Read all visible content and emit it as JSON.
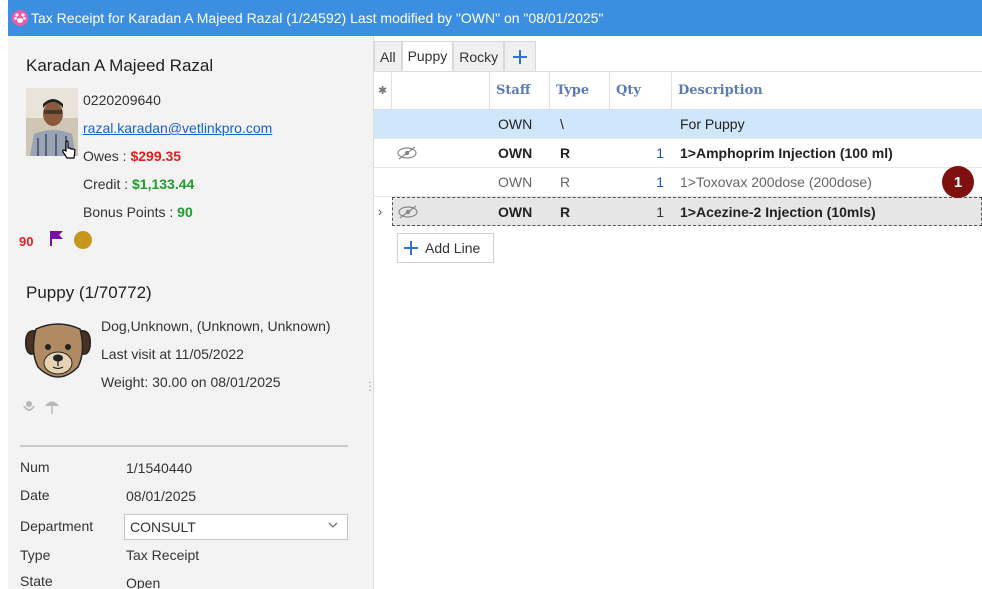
{
  "window": {
    "title": "Tax Receipt for Karadan A Majeed Razal (1/24592) Last modified by \"OWN\" on \"08/01/2025\""
  },
  "client": {
    "name": "Karadan A Majeed Razal",
    "phone": "0220209640",
    "email": "razal.karadan@vetlinkpro.com",
    "owes_label": "Owes : ",
    "owes_value": "$299.35",
    "credit_label": "Credit : ",
    "credit_value": "$1,133.44",
    "bonus_label": "Bonus Points : ",
    "bonus_value": "90",
    "badge_value": "90",
    "colors": {
      "owes": "#e02020",
      "credit": "#1e9d2c",
      "flag": "#7a0fa8",
      "coin": "#c8961f"
    }
  },
  "patient": {
    "name": "Puppy (1/70772)",
    "species": "Dog,Unknown, (Unknown, Unknown)",
    "last_visit": "Last visit at 11/05/2022",
    "weight": "Weight: 30.00 on 08/01/2025"
  },
  "fields": {
    "num_label": "Num",
    "num_value": "1/1540440",
    "date_label": "Date",
    "date_value": "08/01/2025",
    "department_label": "Department",
    "department_value": "CONSULT",
    "type_label": "Type",
    "type_value": "Tax Receipt",
    "state_label": "State",
    "state_value": "Open"
  },
  "tabs": [
    {
      "label": "All"
    },
    {
      "label": "Puppy",
      "active": true
    },
    {
      "label": "Rocky"
    }
  ],
  "grid": {
    "headers": {
      "staff": "Staff",
      "type": "Type",
      "qty": "Qty",
      "description": "Description"
    },
    "rows": [
      {
        "staff": "OWN",
        "type": "\\",
        "qty": "",
        "description": "For Puppy",
        "style": "selected",
        "icon": ""
      },
      {
        "staff": "OWN",
        "type": "R",
        "qty": "1",
        "description": "1>Amphoprim Injection (100 ml)",
        "style": "bold",
        "icon": "eye-slash-icon"
      },
      {
        "staff": "OWN",
        "type": "R",
        "qty": "1",
        "description": "1>Toxovax 200dose (200dose)",
        "style": "muted",
        "icon": ""
      },
      {
        "staff": "OWN",
        "type": "R",
        "qty": "1",
        "description": "1>Acezine-2 Injection (10mls)",
        "style": "current",
        "icon": "eye-slash-icon"
      }
    ],
    "step_badge": "1",
    "add_line_label": "Add Line"
  }
}
